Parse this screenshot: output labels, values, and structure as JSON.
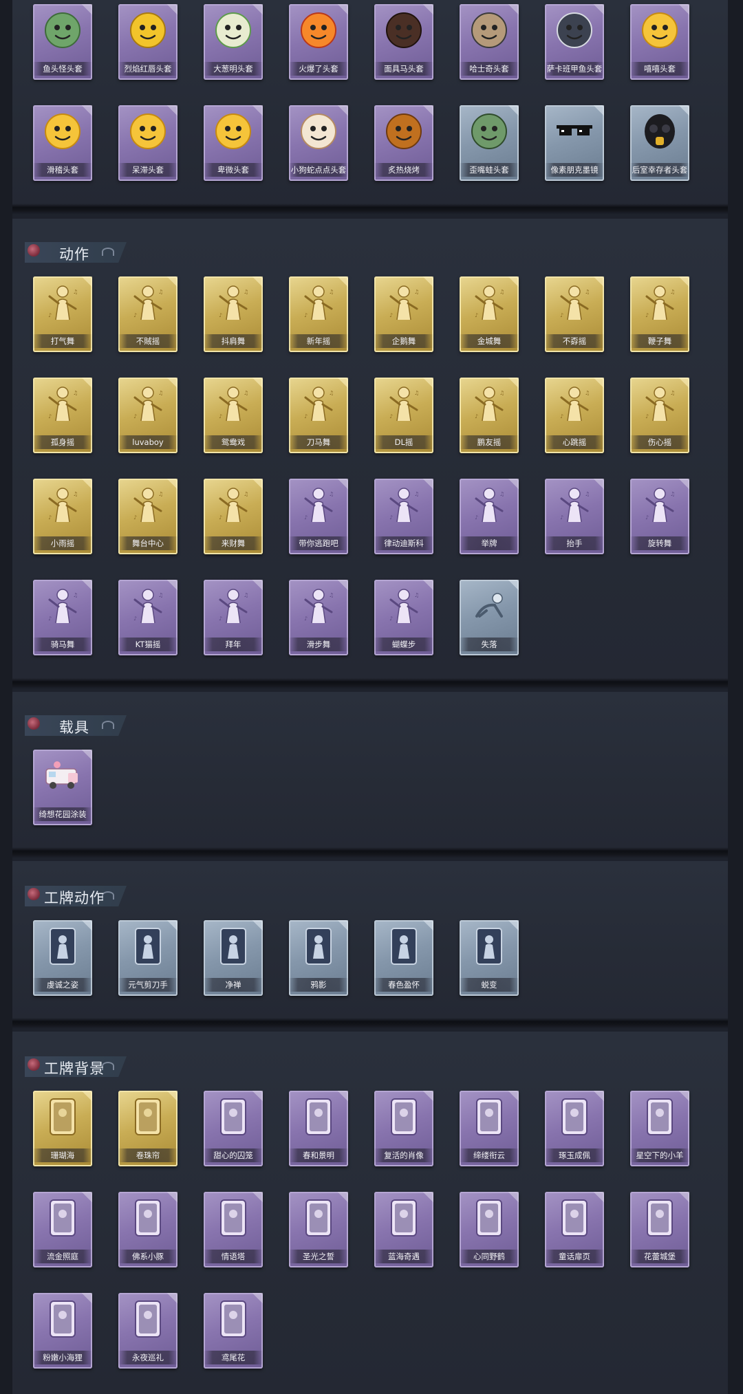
{
  "colors": {
    "purple": "#8874ae",
    "gold": "#c9ad55",
    "blue": "#8597ab",
    "panel": "#2a303c",
    "text": "#f2f2f6"
  },
  "sections": [
    {
      "title": "",
      "items": [
        {
          "label": "鱼头怪头套",
          "rarity": "purple",
          "icon": "fish-head-mask-icon"
        },
        {
          "label": "烈焰红唇头套",
          "rarity": "purple",
          "icon": "yellow-duck-sunglasses-mask-icon"
        },
        {
          "label": "大葱明头套",
          "rarity": "purple",
          "icon": "green-onion-mask-icon"
        },
        {
          "label": "火爆了头套",
          "rarity": "purple",
          "icon": "fire-face-mask-icon"
        },
        {
          "label": "面具马头套",
          "rarity": "purple",
          "icon": "horse-head-mask-icon"
        },
        {
          "label": "哈士奇头套",
          "rarity": "purple",
          "icon": "husky-sunglasses-mask-icon"
        },
        {
          "label": "萨卡班甲鱼头套",
          "rarity": "purple",
          "icon": "fish-face-mask-icon"
        },
        {
          "label": "嘻嘻头套",
          "rarity": "purple",
          "icon": "grin-emoji-mask-icon"
        },
        {
          "label": "滑稽头套",
          "rarity": "purple",
          "icon": "funny-emoji-mask-icon"
        },
        {
          "label": "呆滞头套",
          "rarity": "purple",
          "icon": "dazed-emoji-mask-icon"
        },
        {
          "label": "卑微头套",
          "rarity": "purple",
          "icon": "humble-emoji-mask-icon"
        },
        {
          "label": "小狗蛇点点头套",
          "rarity": "purple",
          "icon": "dog-snake-mask-icon"
        },
        {
          "label": "炙热烧烤",
          "rarity": "purple",
          "icon": "barbecue-mask-icon"
        },
        {
          "label": "歪嘴蛙头套",
          "rarity": "blue",
          "icon": "frog-mask-icon"
        },
        {
          "label": "像素朋克墨镜",
          "rarity": "blue",
          "icon": "pixel-sunglasses-icon"
        },
        {
          "label": "后室幸存者头套",
          "rarity": "blue",
          "icon": "gas-mask-icon"
        }
      ]
    },
    {
      "title": "动作",
      "items": [
        {
          "label": "打气舞",
          "rarity": "gold",
          "icon": "dance-pose-icon"
        },
        {
          "label": "不賊摇",
          "rarity": "gold",
          "icon": "dance-pose-icon"
        },
        {
          "label": "抖肩舞",
          "rarity": "gold",
          "icon": "dance-pose-icon"
        },
        {
          "label": "新年摇",
          "rarity": "gold",
          "icon": "dance-pose-icon"
        },
        {
          "label": "企鹅舞",
          "rarity": "gold",
          "icon": "dance-pose-icon"
        },
        {
          "label": "金城舞",
          "rarity": "gold",
          "icon": "dance-pose-icon"
        },
        {
          "label": "不孬摇",
          "rarity": "gold",
          "icon": "dance-pose-icon"
        },
        {
          "label": "鞭子舞",
          "rarity": "gold",
          "icon": "dance-pose-icon"
        },
        {
          "label": "孤身摇",
          "rarity": "gold",
          "icon": "dance-pose-icon"
        },
        {
          "label": "luvaboy",
          "rarity": "gold",
          "icon": "dance-pose-icon"
        },
        {
          "label": "鸳鸯戏",
          "rarity": "gold",
          "icon": "dance-pose-icon"
        },
        {
          "label": "刀马舞",
          "rarity": "gold",
          "icon": "dance-pose-icon"
        },
        {
          "label": "DL摇",
          "rarity": "gold",
          "icon": "dance-pose-icon"
        },
        {
          "label": "鹏友摇",
          "rarity": "gold",
          "icon": "dance-pose-icon"
        },
        {
          "label": "心跳摇",
          "rarity": "gold",
          "icon": "dance-pose-icon"
        },
        {
          "label": "伤心摇",
          "rarity": "gold",
          "icon": "dance-pose-icon"
        },
        {
          "label": "小雨摇",
          "rarity": "gold",
          "icon": "dance-pose-icon"
        },
        {
          "label": "舞台中心",
          "rarity": "gold",
          "icon": "dance-pose-icon"
        },
        {
          "label": "来财舞",
          "rarity": "gold",
          "icon": "dance-pose-icon"
        },
        {
          "label": "带你逃跑吧",
          "rarity": "purple",
          "icon": "dance-pose-icon"
        },
        {
          "label": "律动迪斯科",
          "rarity": "purple",
          "icon": "dance-pose-icon"
        },
        {
          "label": "举牌",
          "rarity": "purple",
          "icon": "sign-hold-pose-icon"
        },
        {
          "label": "抬手",
          "rarity": "purple",
          "icon": "dance-pose-icon"
        },
        {
          "label": "旋转舞",
          "rarity": "purple",
          "icon": "dance-pose-icon"
        },
        {
          "label": "骑马舞",
          "rarity": "purple",
          "icon": "dance-pose-icon"
        },
        {
          "label": "KT猫摇",
          "rarity": "purple",
          "icon": "dance-pose-icon"
        },
        {
          "label": "拜年",
          "rarity": "purple",
          "icon": "dance-pose-icon"
        },
        {
          "label": "滑步舞",
          "rarity": "purple",
          "icon": "dance-pose-icon"
        },
        {
          "label": "蝴蝶步",
          "rarity": "purple",
          "icon": "dance-pose-icon"
        },
        {
          "label": "失落",
          "rarity": "blue",
          "icon": "crawl-pose-icon"
        }
      ]
    },
    {
      "title": "载具",
      "items": [
        {
          "label": "绮想花园涂装",
          "rarity": "purple",
          "icon": "ice-cream-truck-icon"
        }
      ]
    },
    {
      "title": "工牌动作",
      "items": [
        {
          "label": "虔诚之姿",
          "rarity": "blue",
          "icon": "badge-pose-icon"
        },
        {
          "label": "元气剪刀手",
          "rarity": "blue",
          "icon": "badge-pose-icon"
        },
        {
          "label": "净禅",
          "rarity": "blue",
          "icon": "badge-pose-icon"
        },
        {
          "label": "鸦影",
          "rarity": "blue",
          "icon": "badge-pose-icon"
        },
        {
          "label": "春色盈怀",
          "rarity": "blue",
          "icon": "badge-pose-icon"
        },
        {
          "label": "蜕变",
          "rarity": "blue",
          "icon": "badge-pose-icon"
        }
      ]
    },
    {
      "title": "工牌背景",
      "items": [
        {
          "label": "珊瑚海",
          "rarity": "gold",
          "icon": "badge-background-icon"
        },
        {
          "label": "卷珠帘",
          "rarity": "gold",
          "icon": "badge-background-icon"
        },
        {
          "label": "甜心的囚笼",
          "rarity": "purple",
          "icon": "badge-background-icon"
        },
        {
          "label": "春和景明",
          "rarity": "purple",
          "icon": "badge-background-icon"
        },
        {
          "label": "复活的肖像",
          "rarity": "purple",
          "icon": "badge-background-icon"
        },
        {
          "label": "缔缕衔云",
          "rarity": "purple",
          "icon": "badge-background-icon"
        },
        {
          "label": "琢玉成佩",
          "rarity": "purple",
          "icon": "badge-background-icon"
        },
        {
          "label": "星空下的小羊",
          "rarity": "purple",
          "icon": "badge-background-icon"
        },
        {
          "label": "流金照庭",
          "rarity": "purple",
          "icon": "badge-background-icon"
        },
        {
          "label": "佛系小豚",
          "rarity": "purple",
          "icon": "badge-background-icon"
        },
        {
          "label": "情语塔",
          "rarity": "purple",
          "icon": "badge-background-icon"
        },
        {
          "label": "圣光之誓",
          "rarity": "purple",
          "icon": "badge-background-icon"
        },
        {
          "label": "蓝海奇遇",
          "rarity": "purple",
          "icon": "badge-background-icon"
        },
        {
          "label": "心同野鹤",
          "rarity": "purple",
          "icon": "badge-background-icon"
        },
        {
          "label": "童话扉页",
          "rarity": "purple",
          "icon": "badge-background-icon"
        },
        {
          "label": "花蕾城堡",
          "rarity": "purple",
          "icon": "badge-background-icon"
        },
        {
          "label": "粉嫩小海狸",
          "rarity": "purple",
          "icon": "badge-background-icon"
        },
        {
          "label": "永夜巡礼",
          "rarity": "purple",
          "icon": "badge-background-icon"
        },
        {
          "label": "鸢尾花",
          "rarity": "purple",
          "icon": "badge-background-icon"
        }
      ]
    }
  ]
}
